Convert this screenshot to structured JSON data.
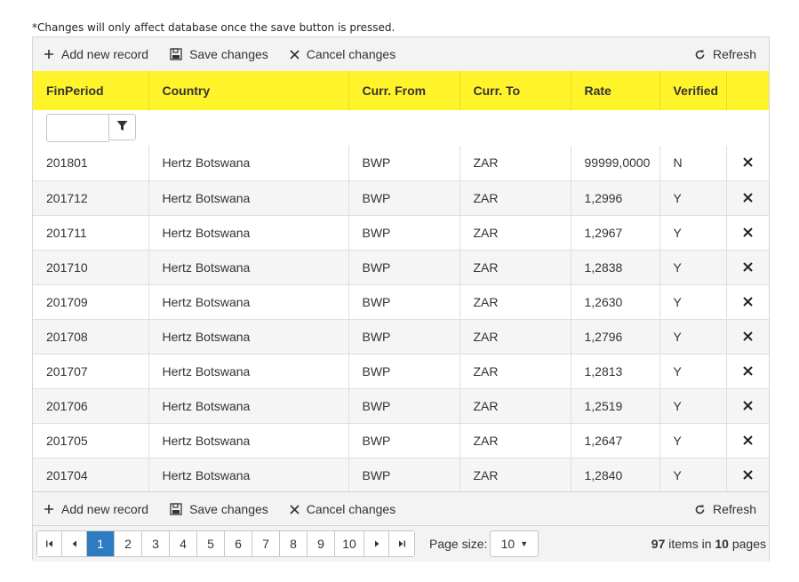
{
  "note": "*Changes will only affect database once the save button is pressed.",
  "toolbar": {
    "add_label": "Add new record",
    "save_label": "Save changes",
    "cancel_label": "Cancel changes",
    "refresh_label": "Refresh"
  },
  "columns": [
    "FinPeriod",
    "Country",
    "Curr. From",
    "Curr. To",
    "Rate",
    "Verified",
    ""
  ],
  "rows": [
    [
      "201801",
      "Hertz Botswana",
      "BWP",
      "ZAR",
      "99999,0000",
      "N"
    ],
    [
      "201712",
      "Hertz Botswana",
      "BWP",
      "ZAR",
      "1,2996",
      "Y"
    ],
    [
      "201711",
      "Hertz Botswana",
      "BWP",
      "ZAR",
      "1,2967",
      "Y"
    ],
    [
      "201710",
      "Hertz Botswana",
      "BWP",
      "ZAR",
      "1,2838",
      "Y"
    ],
    [
      "201709",
      "Hertz Botswana",
      "BWP",
      "ZAR",
      "1,2630",
      "Y"
    ],
    [
      "201708",
      "Hertz Botswana",
      "BWP",
      "ZAR",
      "1,2796",
      "Y"
    ],
    [
      "201707",
      "Hertz Botswana",
      "BWP",
      "ZAR",
      "1,2813",
      "Y"
    ],
    [
      "201706",
      "Hertz Botswana",
      "BWP",
      "ZAR",
      "1,2519",
      "Y"
    ],
    [
      "201705",
      "Hertz Botswana",
      "BWP",
      "ZAR",
      "1,2647",
      "Y"
    ],
    [
      "201704",
      "Hertz Botswana",
      "BWP",
      "ZAR",
      "1,2840",
      "Y"
    ]
  ],
  "pager": {
    "pages": [
      "1",
      "2",
      "3",
      "4",
      "5",
      "6",
      "7",
      "8",
      "9",
      "10"
    ],
    "current_page": "1",
    "page_size_label": "Page size:",
    "page_size": "10",
    "total_items": "97",
    "items_in": "items in",
    "total_pages": "10",
    "pages_word": "pages"
  },
  "colors": {
    "header_bg": "#fff32a",
    "selected_page": "#2d7bc0",
    "toolbar_bg": "#f3f3f3"
  },
  "icons": [
    "plus-icon",
    "save-icon",
    "close-icon",
    "refresh-icon",
    "filter-icon",
    "delete-icon",
    "first-page-icon",
    "prev-page-icon",
    "next-page-icon",
    "last-page-icon",
    "caret-down-icon"
  ]
}
